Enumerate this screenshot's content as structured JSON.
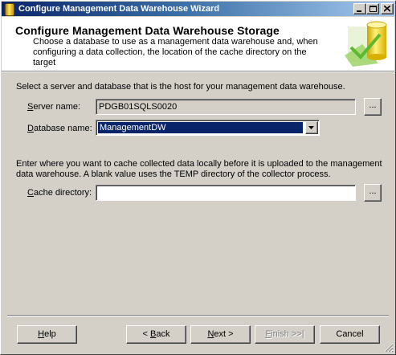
{
  "window": {
    "title": "Configure Management Data Warehouse Wizard",
    "minimize_icon": "minimize-icon",
    "maximize_icon": "maximize-icon",
    "close_icon": "close-icon"
  },
  "header": {
    "title": "Configure Management Data Warehouse Storage",
    "description": "Choose a database to use as a management data warehouse and, when configuring a data collection, the location of the cache directory on the target",
    "art_icon": "database-wizard-icon"
  },
  "server_section": {
    "intro": "Select a server and database that is the host for your management data warehouse.",
    "server_label_hotkey": "S",
    "server_label_rest": "erver name:",
    "server_value": "PDGB01SQLS0020",
    "server_browse_label": "...",
    "database_label_hotkey": "D",
    "database_label_rest": "atabase name:",
    "database_value": "ManagementDW"
  },
  "cache_section": {
    "intro": "Enter where you want to cache collected data locally before it is uploaded to the management data warehouse. A blank value uses the TEMP directory of the collector process.",
    "cache_label_hotkey": "C",
    "cache_label_rest": "ache directory:",
    "cache_value": "",
    "cache_browse_label": "..."
  },
  "footer": {
    "help_hotkey": "H",
    "help_rest": "elp",
    "back_prefix": "< ",
    "back_hotkey": "B",
    "back_rest": "ack",
    "next_hotkey": "N",
    "next_rest": "ext >",
    "finish_hotkey": "F",
    "finish_rest": "inish >>|",
    "cancel_label": "Cancel"
  }
}
